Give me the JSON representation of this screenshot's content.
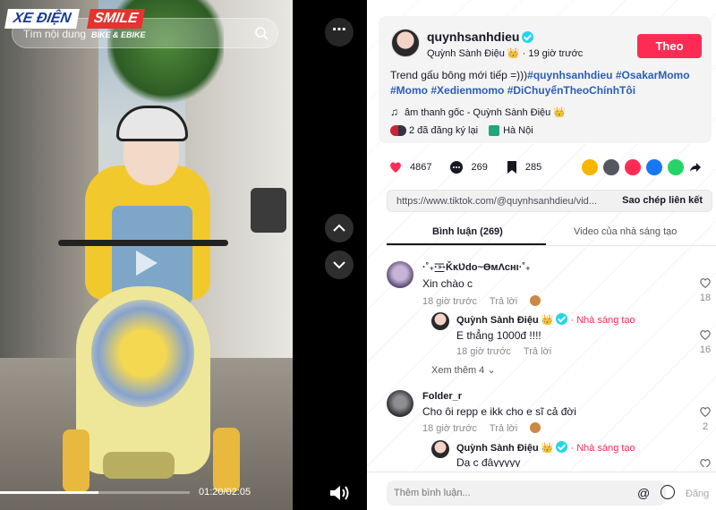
{
  "video": {
    "brand_line1": "XE ĐIỆN",
    "brand_line2": "SMILE",
    "brand_sub": "BIKE & EBIKE",
    "search_placeholder": "Tìm nội dung",
    "progress_fraction": 0.52,
    "time": "01:20/02:05"
  },
  "author": {
    "handle": "quynhsanhdieu",
    "display": "Quỳnh Sành Điệu 👑 · 19 giờ trước",
    "follow_label": "Theo"
  },
  "description": {
    "text": "Trend gấu bông mới tiếp =)))",
    "tags": [
      "#quynhsanhdieu",
      "#OsakarMomo",
      "#Momo",
      "#Xedienmomo",
      "#DiChuyểnTheoChínhTôi"
    ]
  },
  "music": "âm thanh gốc - Quỳnh Sành Điệu 👑",
  "meta": {
    "registered": "2 đã đăng ký lại",
    "location": "Hà Nội"
  },
  "stats": {
    "likes": "4867",
    "comments": "269",
    "saves": "285"
  },
  "share_colors": [
    "#f7b500",
    "#54575f",
    "#fe2c55",
    "#1877f2",
    "#25d366"
  ],
  "link": {
    "url": "https://www.tiktok.com/@quynhsanhdieu/vid...",
    "copy_label": "Sao chép liên kết"
  },
  "tabs": {
    "comments": "Bình luận (269)",
    "videos": "Video của nhà sáng tạo"
  },
  "comments": [
    {
      "user": "·˚₊·͟͟͞͞➳ǨĸƲdo~ƟмΛcнι·˚₊",
      "text": "Xin chào c",
      "time": "18 giờ trước",
      "reply": "Trả lời",
      "likes": "18",
      "creator_reply": {
        "user": "Quỳnh Sành Điệu 👑",
        "tag": "· Nhà sáng tạo",
        "text": "E thẳng 1000đ !!!!",
        "time": "18 giờ trước",
        "reply": "Trả lời",
        "likes": "16"
      },
      "view_more": "Xem thêm 4"
    },
    {
      "user": "Folder_r",
      "text": "Cho ôi repp e ikk cho e sĩ cả đời",
      "time": "18 giờ trước",
      "reply": "Trả lời",
      "likes": "2",
      "creator_reply": {
        "user": "Quỳnh Sành Điệu 👑",
        "tag": "· Nhà sáng tạo",
        "text": "Dạ c đâyyyyy",
        "time": "",
        "reply": "",
        "likes": ""
      }
    }
  ],
  "comment_bar": {
    "placeholder": "Thêm bình luận...",
    "post_label": "Đăng"
  }
}
